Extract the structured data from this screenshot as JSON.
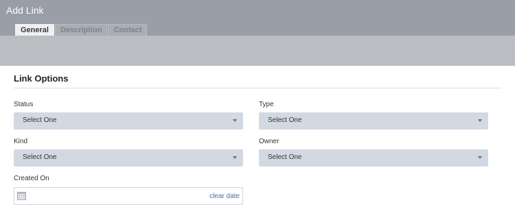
{
  "window": {
    "title": "Add Link"
  },
  "tabs": [
    {
      "label": "General",
      "active": true
    },
    {
      "label": "Description",
      "active": false
    },
    {
      "label": "Contact",
      "active": false
    }
  ],
  "section": {
    "title": "Link Options"
  },
  "fields": {
    "status": {
      "label": "Status",
      "value": "Select One"
    },
    "type": {
      "label": "Type",
      "value": "Select One"
    },
    "kind": {
      "label": "Kind",
      "value": "Select One"
    },
    "owner": {
      "label": "Owner",
      "value": "Select One"
    },
    "created_on": {
      "label": "Created On",
      "value": "",
      "clear_label": "clear date",
      "icon": "calendar-icon"
    }
  },
  "colors": {
    "header_bg": "#9a9ea6",
    "select_bg": "#d3d9e2",
    "link": "#4e6ea8"
  }
}
